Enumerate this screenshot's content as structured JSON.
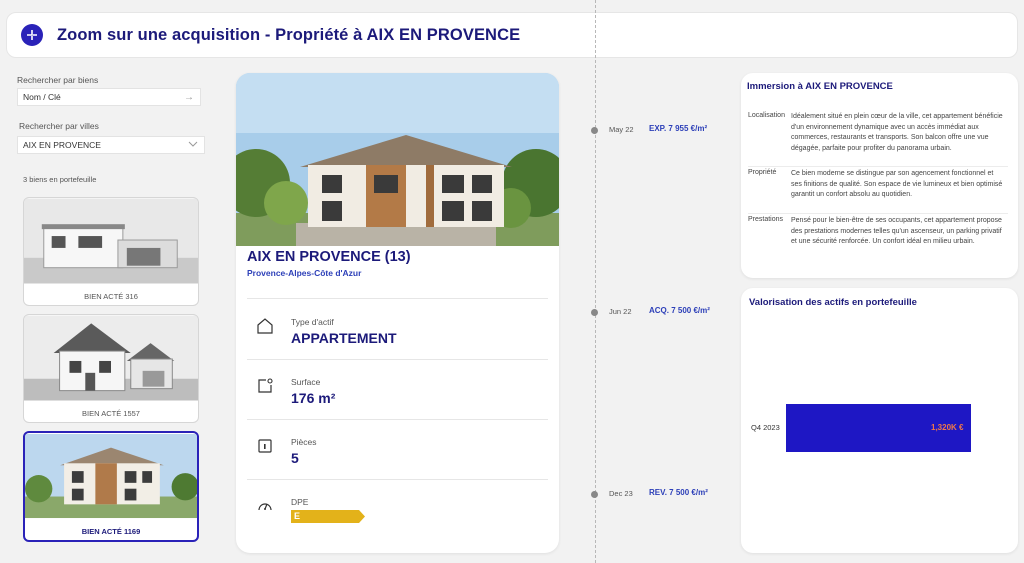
{
  "header": {
    "title": "Zoom sur une acquisition - Propriété à AIX EN PROVENCE"
  },
  "search": {
    "by_property_label": "Rechercher par biens",
    "by_property_value": "Nom / Clé",
    "by_city_label": "Rechercher par villes",
    "by_city_value": "AIX EN PROVENCE",
    "count_label": "3 biens en portefeuille"
  },
  "cards": [
    {
      "label": "BIEN ACTÉ 316"
    },
    {
      "label": "BIEN ACTÉ 1557"
    },
    {
      "label": "BIEN ACTÉ 1169"
    }
  ],
  "property": {
    "title": "AIX EN PROVENCE (13)",
    "region": "Provence-Alpes-Côte d'Azur",
    "type_label": "Type d'actif",
    "type_value": "APPARTEMENT",
    "surface_label": "Surface",
    "surface_value": "176 m²",
    "rooms_label": "Pièces",
    "rooms_value": "5",
    "dpe_label": "DPE",
    "dpe_value": "E",
    "dpe_color": "#e3b21a"
  },
  "timeline": [
    {
      "date": "May 22",
      "value": "EXP. 7 955 €/m²"
    },
    {
      "date": "Jun 22",
      "value": "ACQ. 7 500 €/m²"
    },
    {
      "date": "Dec 23",
      "value": "REV. 7 500 €/m²"
    }
  ],
  "immersion": {
    "title": "Immersion à AIX EN PROVENCE",
    "rows": [
      {
        "key": "Localisation",
        "text": "Idéalement situé en plein cœur de la ville, cet appartement bénéficie d'un environnement dynamique avec un accès immédiat aux commerces, restaurants et transports. Son balcon offre une vue dégagée, parfaite pour profiter du panorama urbain."
      },
      {
        "key": "Propriété",
        "text": "Ce bien moderne se distingue par son agencement fonctionnel et ses finitions de qualité. Son espace de vie lumineux et bien optimisé garantit un confort absolu au quotidien."
      },
      {
        "key": "Prestations",
        "text": "Pensé pour le bien-être de ses occupants, cet appartement propose des prestations modernes telles qu'un ascenseur, un parking privatif et une sécurité renforcée. Un confort idéal en milieu urbain."
      }
    ]
  },
  "valuation": {
    "title": "Valorisation des actifs en portefeuille"
  },
  "chart_data": {
    "type": "bar",
    "orientation": "horizontal",
    "categories": [
      "Q4 2023"
    ],
    "values": [
      1320
    ],
    "value_labels": [
      "1,320K €"
    ],
    "bar_color": "#1e17c4",
    "label_color": "#f07848"
  }
}
